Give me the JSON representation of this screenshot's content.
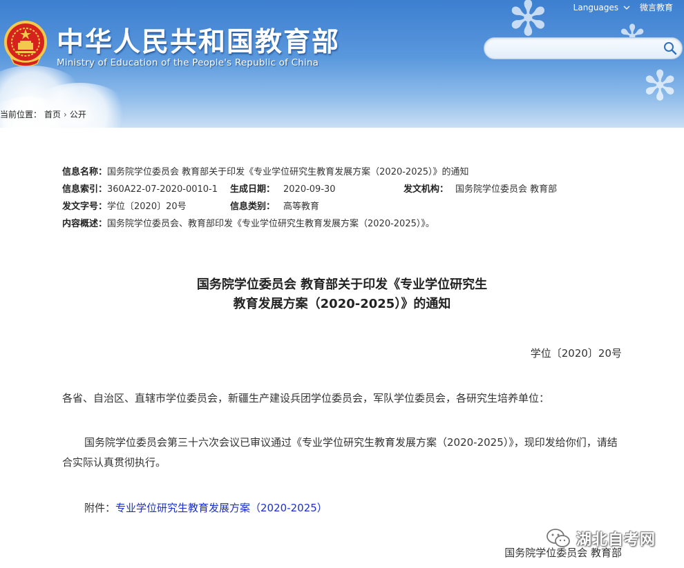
{
  "header": {
    "languages_label": "Languages",
    "weibo_label": "微言教育",
    "title_cn": "中华人民共和国教育部",
    "title_en": "Ministry of Education of the People's Republic of China",
    "search_placeholder": ""
  },
  "breadcrumb": {
    "prefix": "当前位置：",
    "home": "首页",
    "current": "公开"
  },
  "meta": {
    "name_label": "信息名称：",
    "name_value": "国务院学位委员会 教育部关于印发《专业学位研究生教育发展方案（2020-2025）》的通知",
    "index_label": "信息索引：",
    "index_value": "360A22-07-2020-0010-1",
    "date_label": "生成日期：",
    "date_value": "2020-09-30",
    "issuer_label": "发文机构：",
    "issuer_value": "国务院学位委员会 教育部",
    "docno_label": "发文字号：",
    "docno_value": "学位〔2020〕20号",
    "category_label": "信息类别：",
    "category_value": "高等教育",
    "summary_label": "内容概述：",
    "summary_value": "国务院学位委员会、教育部印发《专业学位研究生教育发展方案（2020-2025）》。"
  },
  "document": {
    "title_line1": "国务院学位委员会 教育部关于印发《专业学位研究生",
    "title_line2": "教育发展方案（2020-2025）》的通知",
    "doc_number": "学位〔2020〕20号",
    "addressees": "各省、自治区、直辖市学位委员会，新疆生产建设兵团学位委员会，军队学位委员会，各研究生培养单位：",
    "body": "国务院学位委员会第三十六次会议已审议通过《专业学位研究生教育发展方案（2020-2025）》，现印发给你们，请结合实际认真贯彻执行。",
    "attachment_label": "附件：",
    "attachment_link": "专业学位研究生教育发展方案（2020-2025）",
    "signer": "国务院学位委员会 教育部"
  },
  "watermark": {
    "text": "湖北自考网"
  },
  "colors": {
    "header_top": "#3d7fd0",
    "link": "#1a2fcf",
    "emblem_red": "#d6221c",
    "emblem_gold": "#f2c94c"
  },
  "icons": {
    "search": "search-icon",
    "emblem": "national-emblem-icon",
    "languages_dropdown": "chevron-down-icon",
    "wechat": "wechat-icon"
  }
}
